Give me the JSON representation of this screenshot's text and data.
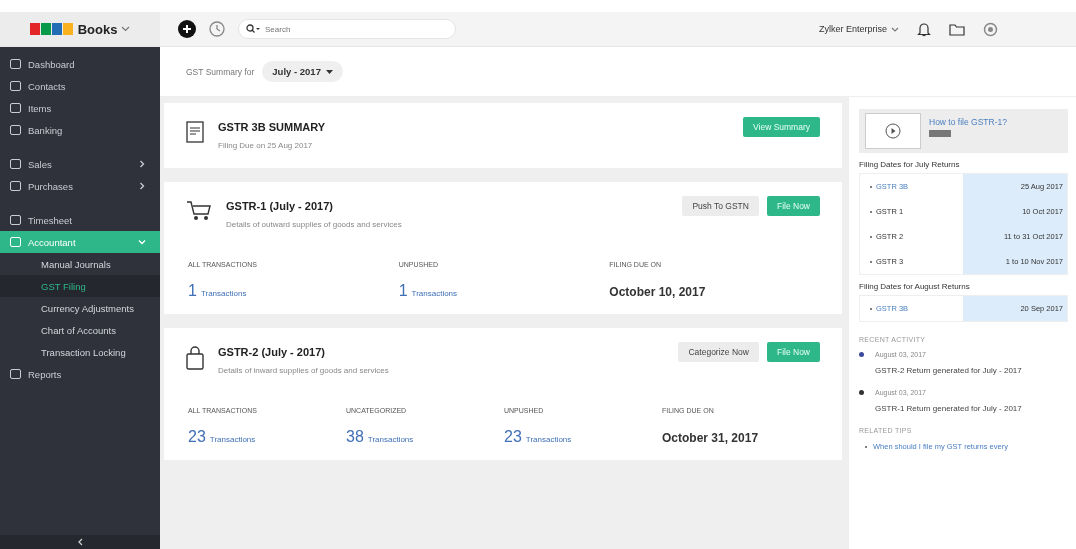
{
  "header": {
    "app_name": "Books",
    "search": {
      "placeholder": "Search"
    },
    "organization": "Zylker Enterprise"
  },
  "sidebar": {
    "sections": [
      {
        "items": [
          {
            "label": "Dashboard",
            "selected": false
          },
          {
            "label": "Contacts",
            "selected": false
          },
          {
            "label": "Items",
            "selected": false
          },
          {
            "label": "Banking",
            "selected": false
          }
        ]
      },
      {
        "items": [
          {
            "label": "Sales",
            "expanded": false,
            "selected": false
          },
          {
            "label": "Purchases",
            "expanded": false,
            "selected": false
          }
        ]
      },
      {
        "items": [
          {
            "label": "Timesheet",
            "selected": false
          },
          {
            "label": "Accountant",
            "expanded": true,
            "selected": true,
            "children": [
              {
                "label": "Manual Journals",
                "selected": false
              },
              {
                "label": "GST Filing",
                "selected": true
              },
              {
                "label": "Currency Adjustments",
                "selected": false
              },
              {
                "label": "Chart of Accounts",
                "selected": false
              },
              {
                "label": "Transaction Locking",
                "selected": false
              }
            ]
          },
          {
            "label": "Reports",
            "selected": false
          }
        ]
      }
    ]
  },
  "period": {
    "label": "GST Summary for",
    "value": "July - 2017"
  },
  "returns": [
    {
      "title": "GSTR 3B SUMMARY",
      "subtitle": "Filing Due on 25 Aug 2017",
      "buttons": [
        {
          "label": "View Summary",
          "kind": "primary"
        }
      ]
    },
    {
      "title": "GSTR-1 (July - 2017)",
      "subtitle": "Details of outward supplies of goods and services",
      "buttons": [
        {
          "label": "Push To GSTN",
          "kind": "secondary"
        },
        {
          "label": "File Now",
          "kind": "primary"
        }
      ],
      "stats": [
        {
          "kind": "count",
          "label": "ALL TRANSACTIONS",
          "value": "1",
          "unit": "Transactions"
        },
        {
          "kind": "count",
          "label": "UNPUSHED",
          "value": "1",
          "unit": "Transactions"
        },
        {
          "kind": "date",
          "label": "FILING DUE ON",
          "value": "October 10, 2017"
        }
      ]
    },
    {
      "title": "GSTR-2 (July - 2017)",
      "subtitle": "Details of inward supplies of goods and services",
      "buttons": [
        {
          "label": "Categorize Now",
          "kind": "secondary"
        },
        {
          "label": "File Now",
          "kind": "primary"
        }
      ],
      "stats": [
        {
          "kind": "count",
          "label": "ALL TRANSACTIONS",
          "value": "23",
          "unit": "Transactions"
        },
        {
          "kind": "count",
          "label": "UNCATEGORIZED",
          "value": "38",
          "unit": "Transactions"
        },
        {
          "kind": "count",
          "label": "UNPUSHED",
          "value": "23",
          "unit": "Transactions"
        },
        {
          "kind": "date",
          "label": "FILING DUE ON",
          "value": "October 31, 2017"
        }
      ]
    }
  ],
  "side_panel": {
    "video": {
      "title": "How to file GSTR-1?"
    },
    "filing_dates": [
      {
        "heading": "Filing Dates for July Returns",
        "rows": [
          {
            "form": "GSTR 3B",
            "date": "25 Aug 2017",
            "current": true
          },
          {
            "form": "GSTR 1",
            "date": "10 Oct 2017",
            "current": false
          },
          {
            "form": "GSTR 2",
            "date": "11 to 31 Oct 2017",
            "current": false
          },
          {
            "form": "GSTR 3",
            "date": "1 to 10 Nov 2017",
            "current": false
          }
        ]
      },
      {
        "heading": "Filing Dates for August Returns",
        "rows": [
          {
            "form": "GSTR 3B",
            "date": "20 Sep 2017",
            "current": true
          }
        ]
      }
    ],
    "recent_activity": {
      "heading": "RECENT ACTIVITY",
      "items": [
        {
          "date": "August 03, 2017",
          "text": "GSTR-2 Return generated for July - 2017",
          "color": "#3b4a9a"
        },
        {
          "date": "August 03, 2017",
          "text": "GSTR-1 Return generated for July - 2017",
          "color": "#333333"
        }
      ]
    },
    "related_tips": {
      "heading": "RELATED TIPS",
      "items": [
        "When should I file my GST returns every"
      ]
    }
  }
}
